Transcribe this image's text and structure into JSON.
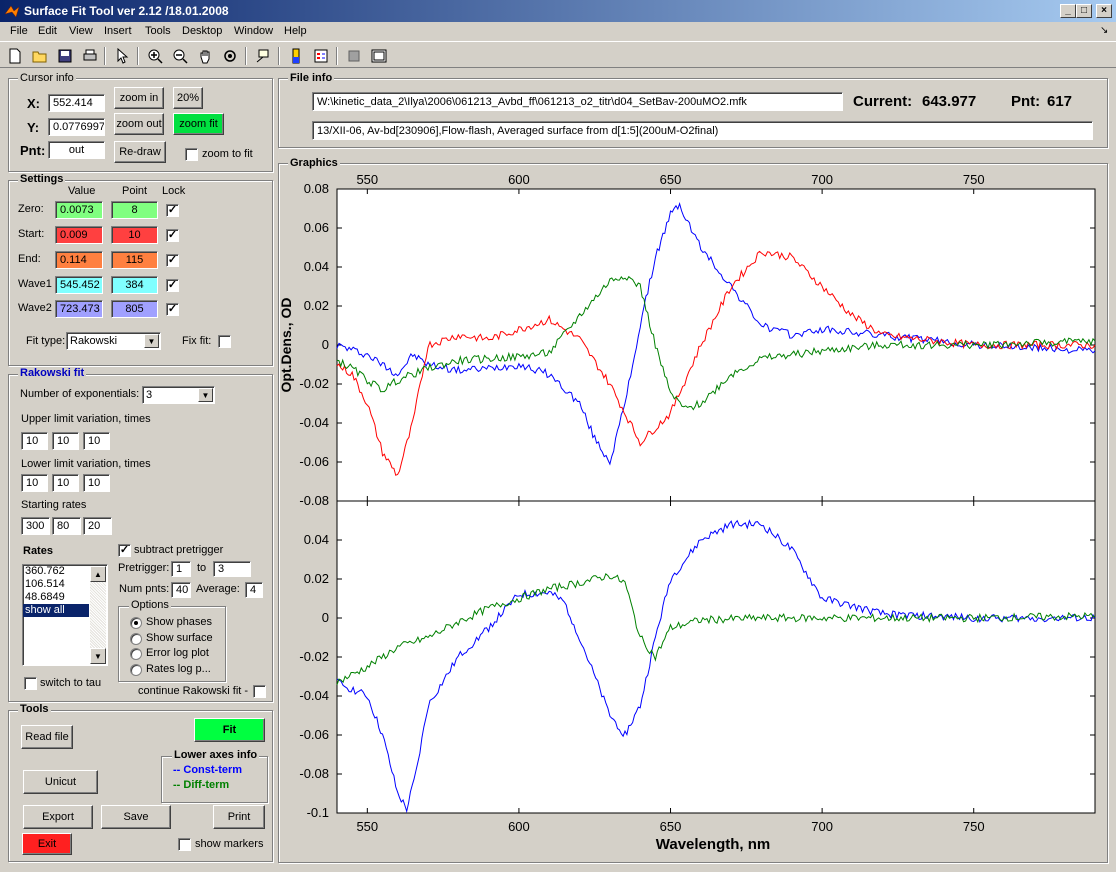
{
  "window": {
    "title": "Surface Fit Tool ver 2.12 /18.01.2008"
  },
  "menu": [
    "File",
    "Edit",
    "View",
    "Insert",
    "Tools",
    "Desktop",
    "Window",
    "Help"
  ],
  "toolbar_icons": [
    "new-file-icon",
    "open-folder-icon",
    "save-icon",
    "print-icon",
    "pointer-icon",
    "zoom-in-icon",
    "zoom-out-icon",
    "pan-hand-icon",
    "rotate-icon",
    "data-cursor-icon",
    "colorbar-icon",
    "legend-icon",
    "hide-plot-tools-icon",
    "show-plot-tools-icon"
  ],
  "cursor_info": {
    "title": "Cursor info",
    "x_label": "X:",
    "x_value": "552.414",
    "y_label": "Y:",
    "y_value": "0.0776997",
    "pnt_label": "Pnt:",
    "pnt_value": "out",
    "zoom_in": "zoom in",
    "zoom_out": "zoom out",
    "redraw": "Re-draw",
    "pct": "20%",
    "zoom_fit": "zoom fit",
    "zoom_to_fit": "zoom to fit"
  },
  "settings": {
    "title": "Settings",
    "col_value": "Value",
    "col_point": "Point",
    "col_lock": "Lock",
    "rows": [
      {
        "label": "Zero:",
        "value": "0.0073",
        "point": "8",
        "color": "#80ff80"
      },
      {
        "label": "Start:",
        "value": "0.009",
        "point": "10",
        "color": "#ff4040"
      },
      {
        "label": "End:",
        "value": "0.114",
        "point": "115",
        "color": "#ff8040"
      },
      {
        "label": "Wave1",
        "value": "545.452",
        "point": "384",
        "color": "#80ffff"
      },
      {
        "label": "Wave2",
        "value": "723.473",
        "point": "805",
        "color": "#a0a0ff"
      }
    ],
    "fit_type_label": "Fit type:",
    "fit_type_value": "Rakowski",
    "fix_fit_label": "Fix fit:"
  },
  "rakowski": {
    "title": "Rakowski fit",
    "num_exp_label": "Number of exponentials:",
    "num_exp_value": "3",
    "upper_label": "Upper limit variation, times",
    "upper": [
      "10",
      "10",
      "10"
    ],
    "lower_label": "Lower limit variation, times",
    "lower": [
      "10",
      "10",
      "10"
    ],
    "rates_start_label": "Starting rates",
    "rates_start": [
      "300",
      "80",
      "20"
    ],
    "rates_label": "Rates",
    "rates_list": [
      "360.762",
      "106.514",
      "48.6849",
      "show all"
    ],
    "subtract_label": "subtract pretrigger",
    "pretrigger_label": "Pretrigger:",
    "pretrigger_from": "1",
    "to_label": "to",
    "pretrigger_to": "3",
    "numpnts_label": "Num pnts:",
    "numpnts_value": "40",
    "average_label": "Average:",
    "average_value": "4",
    "options_title": "Options",
    "options": [
      "Show phases",
      "Show surface",
      "Error log plot",
      "Rates log p..."
    ],
    "switch_tau": "switch to tau",
    "continue_label": "continue Rakowski fit -"
  },
  "tools": {
    "title": "Tools",
    "read_file": "Read file",
    "fit": "Fit",
    "unicut": "Unicut",
    "lower_axes_title": "Lower axes info",
    "const_term": "-- Const-term",
    "diff_term": "-- Diff-term",
    "export": "Export",
    "save": "Save",
    "print": "Print",
    "exit": "Exit",
    "show_markers": "show markers"
  },
  "file_info": {
    "title": "File info",
    "path": "W:\\kinetic_data_2\\Ilya\\2006\\061213_Avbd_ff\\061213_o2_titr\\d04_SetBav-200uMO2.mfk",
    "description": "13/XII-06, Av-bd[230906],Flow-flash, Averaged surface from d[1:5](200uM-O2final)",
    "current_label": "Current:",
    "current_value": "643.977",
    "pnt_label": "Pnt:",
    "pnt_value": "617"
  },
  "graphics": {
    "title": "Graphics"
  },
  "chart_data": [
    {
      "type": "line",
      "xlim": [
        540,
        790
      ],
      "ylim": [
        -0.08,
        0.08
      ],
      "x_ticks": [
        550,
        600,
        650,
        700,
        750
      ],
      "y_ticks": [
        "0.08",
        "0.06",
        "0.04",
        "0.02",
        "0",
        "-0.02",
        "-0.04",
        "-0.06",
        "-0.08"
      ],
      "ylabel": "Opt.Dens., OD",
      "series": [
        {
          "color": "#0000ff",
          "x": [
            540,
            550,
            555,
            560,
            565,
            570,
            580,
            590,
            600,
            610,
            620,
            625,
            630,
            635,
            640,
            645,
            650,
            653,
            655,
            660,
            670,
            680,
            690,
            700,
            720,
            750,
            790
          ],
          "y": [
            0,
            -0.005,
            -0.01,
            -0.015,
            -0.005,
            -0.01,
            -0.013,
            -0.012,
            -0.01,
            -0.015,
            -0.03,
            -0.048,
            -0.06,
            -0.03,
            0.01,
            0.045,
            0.067,
            0.072,
            0.065,
            0.05,
            0.03,
            0.01,
            0.005,
            0.008,
            0.005,
            0,
            -0.003
          ]
        },
        {
          "color": "#ff0000",
          "x": [
            540,
            545,
            550,
            555,
            560,
            565,
            570,
            580,
            590,
            600,
            610,
            620,
            630,
            640,
            650,
            660,
            670,
            680,
            690,
            700,
            710,
            720,
            750,
            790
          ],
          "y": [
            -0.01,
            -0.015,
            -0.03,
            -0.055,
            -0.067,
            -0.04,
            0,
            0.005,
            0.003,
            0.008,
            0.013,
            0.003,
            -0.02,
            -0.05,
            -0.035,
            0,
            0.03,
            0.048,
            0.045,
            0.03,
            0.015,
            0.005,
            0,
            0
          ]
        },
        {
          "color": "#008000",
          "x": [
            540,
            545,
            550,
            555,
            560,
            570,
            580,
            590,
            600,
            610,
            620,
            630,
            635,
            640,
            645,
            650,
            655,
            660,
            670,
            680,
            700,
            720,
            750,
            790
          ],
          "y": [
            -0.008,
            -0.012,
            -0.018,
            -0.023,
            -0.018,
            -0.012,
            -0.008,
            -0.007,
            -0.006,
            -0.004,
            0.015,
            0.033,
            0.036,
            0.03,
            0,
            -0.025,
            -0.033,
            -0.03,
            -0.015,
            -0.007,
            -0.003,
            0,
            0,
            0.002
          ]
        }
      ]
    },
    {
      "type": "line",
      "xlim": [
        540,
        790
      ],
      "ylim": [
        -0.1,
        0.06
      ],
      "x_ticks": [
        550,
        600,
        650,
        700,
        750
      ],
      "y_ticks": [
        "0.04",
        "0.02",
        "0",
        "-0.02",
        "-0.04",
        "-0.06",
        "-0.08",
        "-0.1"
      ],
      "xlabel": "Wavelength, nm",
      "series": [
        {
          "color": "#0000ff",
          "x": [
            540,
            550,
            555,
            560,
            563,
            566,
            570,
            580,
            590,
            600,
            610,
            615,
            620,
            630,
            635,
            640,
            645,
            650,
            660,
            670,
            680,
            690,
            700,
            720,
            750,
            790
          ],
          "y": [
            -0.033,
            -0.04,
            -0.06,
            -0.09,
            -0.098,
            -0.08,
            -0.045,
            -0.02,
            -0.005,
            0.012,
            0.013,
            0.008,
            -0.01,
            -0.05,
            -0.06,
            -0.045,
            -0.01,
            0.02,
            0.04,
            0.048,
            0.048,
            0.035,
            0.01,
            0.002,
            0,
            0
          ]
        },
        {
          "color": "#008000",
          "x": [
            540,
            550,
            560,
            570,
            580,
            590,
            600,
            610,
            620,
            630,
            635,
            640,
            645,
            650,
            660,
            680,
            700,
            720,
            750,
            790
          ],
          "y": [
            -0.033,
            -0.025,
            -0.015,
            -0.01,
            -0.002,
            0.005,
            0.01,
            0.015,
            0.018,
            0.022,
            0.018,
            -0.01,
            -0.02,
            -0.005,
            -0.001,
            0,
            0,
            0,
            0,
            0.001
          ]
        }
      ]
    }
  ]
}
